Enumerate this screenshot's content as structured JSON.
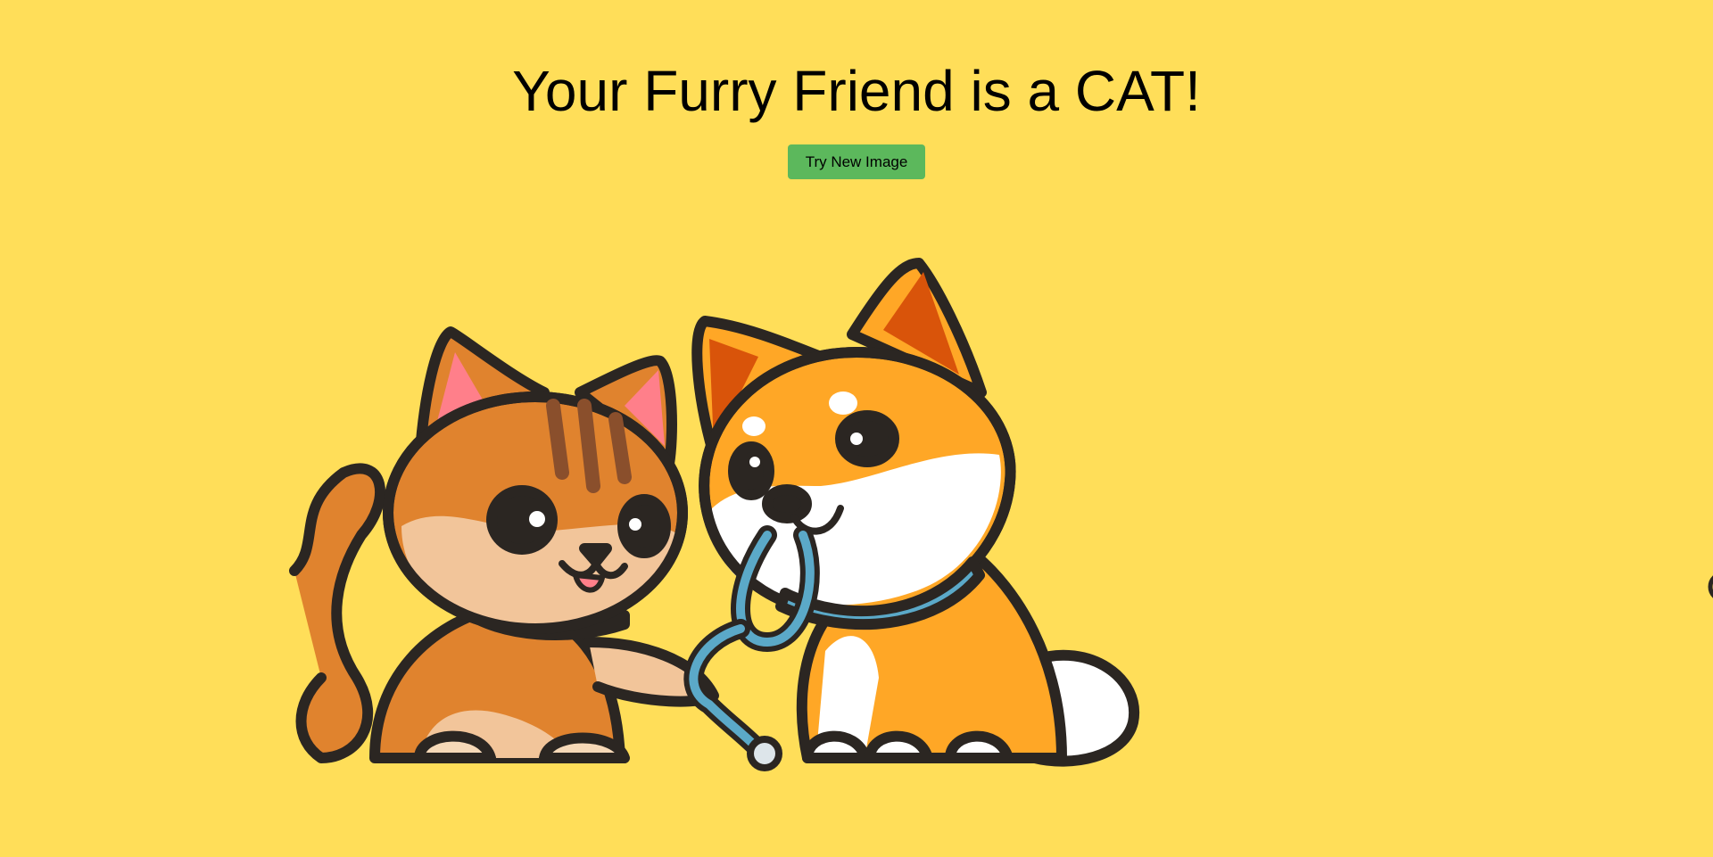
{
  "page": {
    "title": "Your Furry Friend is a CAT!",
    "try_button_label": "Try New Image"
  },
  "colors": {
    "background": "#FFDE59",
    "button": "#5CB85C",
    "outline": "#2B2622",
    "cat_fur": "#E0832E",
    "dog_fur": "#FFA726",
    "leash": "#5BA9C8"
  },
  "illustration": {
    "icon": "cat-and-dog-with-leash-illustration"
  }
}
